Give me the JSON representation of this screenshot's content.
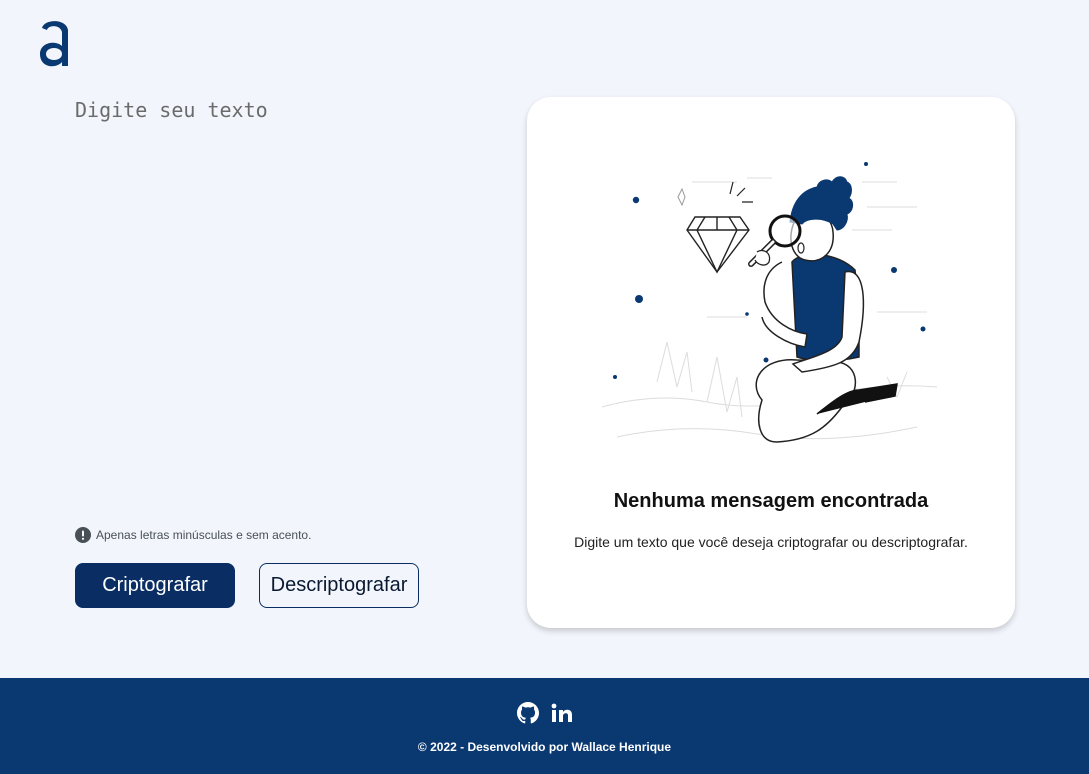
{
  "header": {
    "logo_icon": "alura-a-logo-icon"
  },
  "input": {
    "placeholder": "Digite seu texto",
    "value": ""
  },
  "hint": {
    "icon": "exclamation-circle-icon",
    "text": "Apenas letras minúsculas e sem acento."
  },
  "buttons": {
    "encrypt_label": "Criptografar",
    "decrypt_label": "Descriptografar"
  },
  "output": {
    "illustration": "person-with-magnifying-glass-and-diamond",
    "title": "Nenhuma mensagem encontrada",
    "text": "Digite um texto que você deseja criptografar ou descriptografar."
  },
  "footer": {
    "social_icons": [
      "github-icon",
      "linkedin-icon"
    ],
    "copyright": "© 2022 - Desenvolvido por Wallace Henrique"
  },
  "colors": {
    "primary": "#0a3871",
    "button_primary": "#0a2e63",
    "background": "#f2f5fc",
    "card": "#ffffff"
  }
}
